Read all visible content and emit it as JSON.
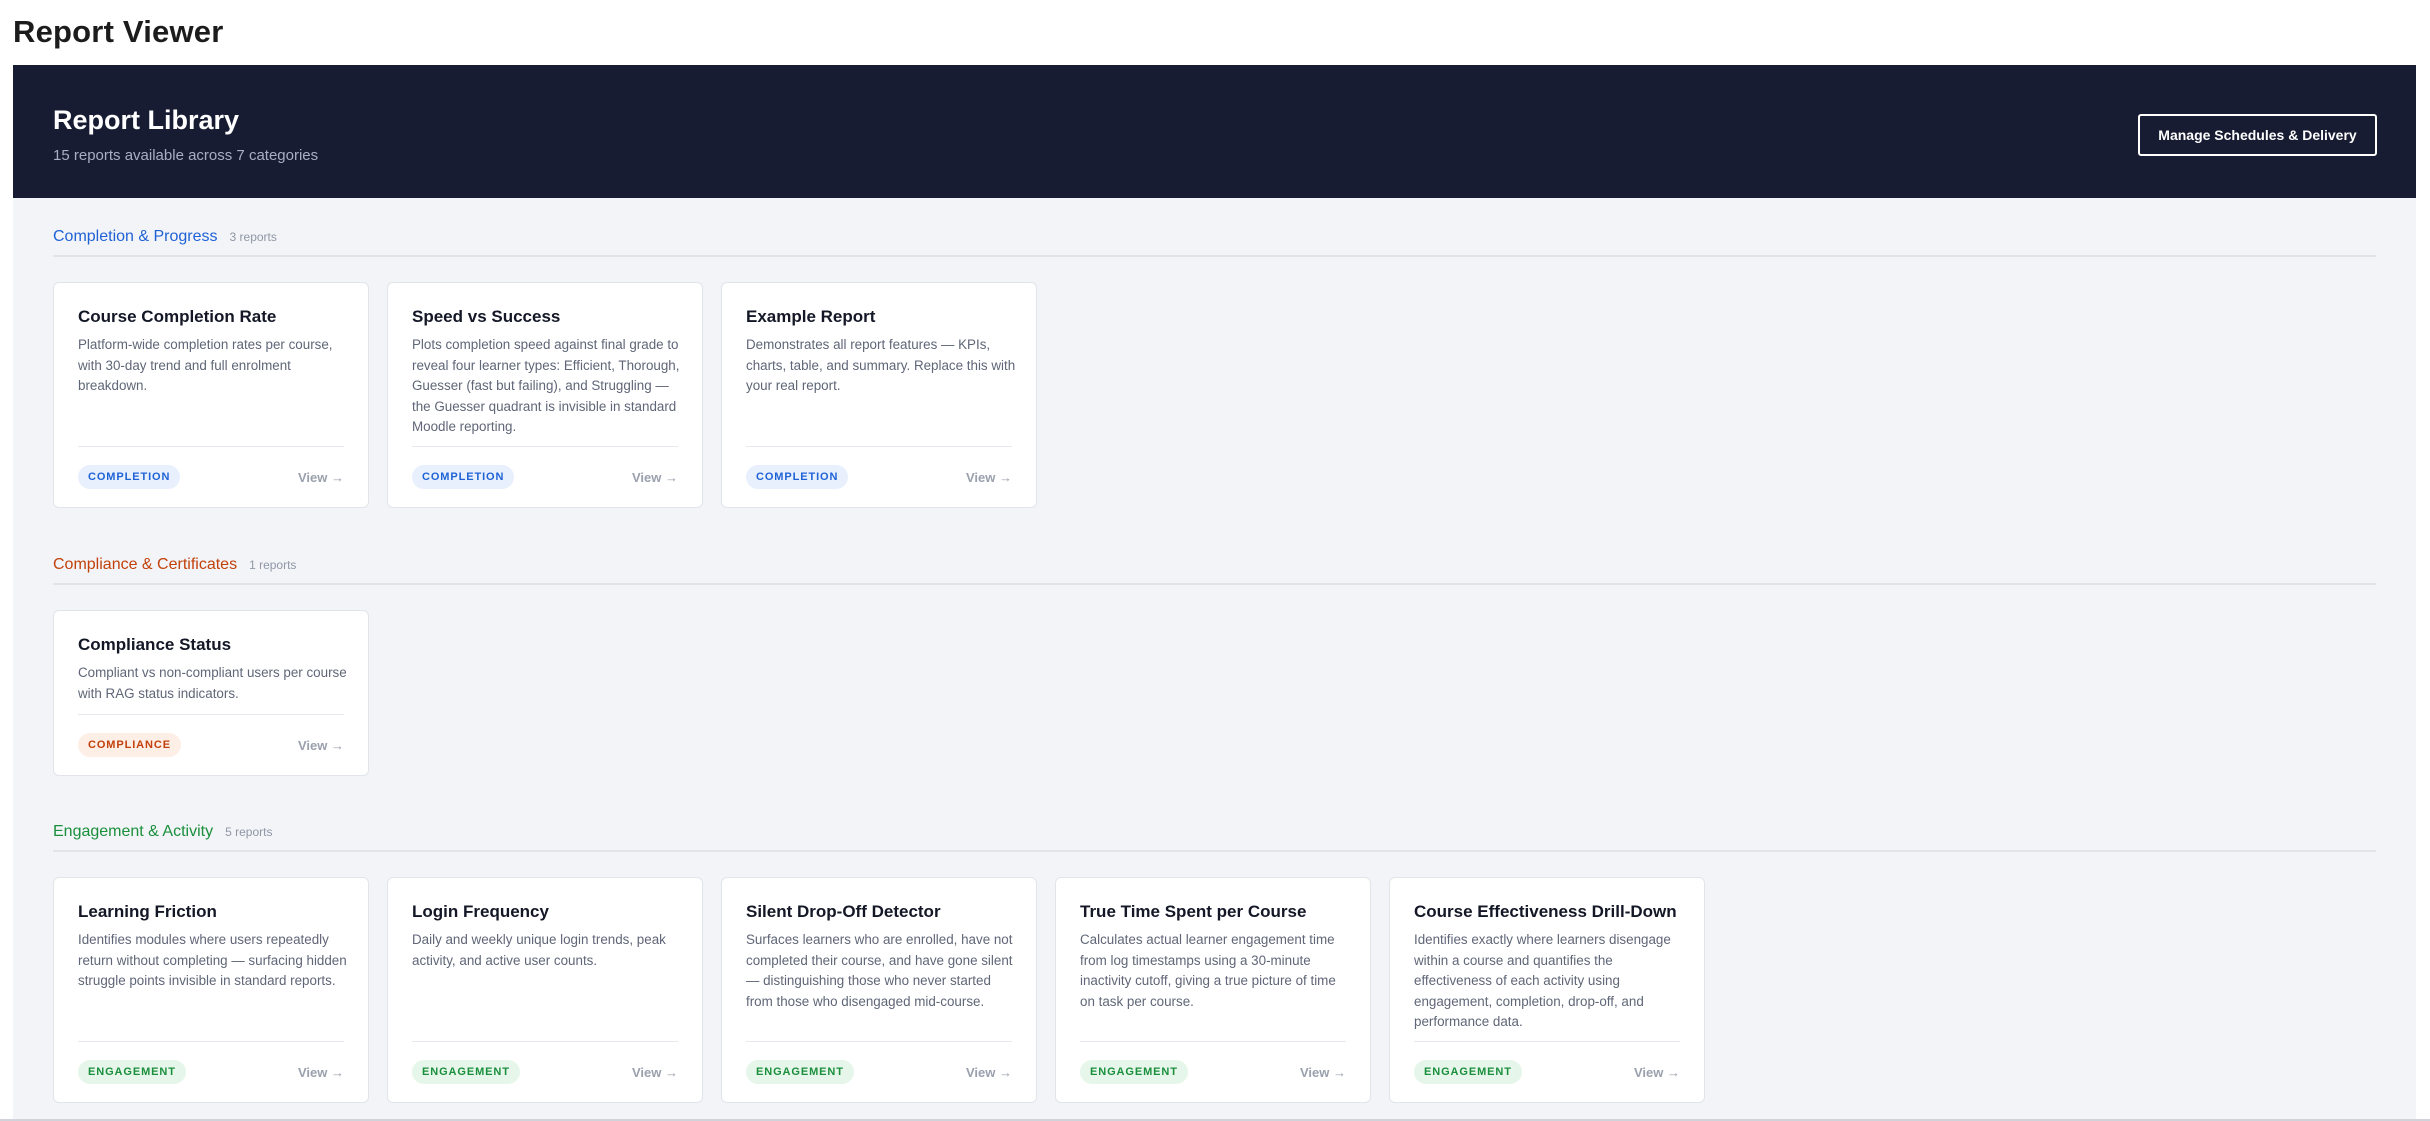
{
  "app": {
    "title": "Report Viewer"
  },
  "header": {
    "title": "Report Library",
    "subtitle": "15 reports available across 7 categories",
    "manage_label": "Manage Schedules & Delivery"
  },
  "colors": {
    "hero_bg": "#171c33",
    "completion": "#1f62d6",
    "completion_bg": "#e8f0fd",
    "compliance": "#c2410c",
    "compliance_bg": "#fdeee6",
    "engagement": "#1a8f3c",
    "engagement_bg": "#e6f6ea"
  },
  "sections": [
    {
      "name": "Completion & Progress",
      "count": "3 reports",
      "badge": "COMPLETION",
      "reports": [
        {
          "title": "Course Completion Rate",
          "description": "Platform-wide completion rates per course, with 30-day trend and full enrolment breakdown.",
          "view": "View →"
        },
        {
          "title": "Speed vs Success",
          "description": "Plots completion speed against final grade to reveal four learner types: Efficient, Thorough, Guesser (fast but failing), and Struggling — the Guesser quadrant is invisible in standard Moodle reporting.",
          "view": "View →"
        },
        {
          "title": "Example Report",
          "description": "Demonstrates all report features — KPIs, charts, table, and summary. Replace this with your real report.",
          "view": "View →"
        }
      ]
    },
    {
      "name": "Compliance & Certificates",
      "count": "1 reports",
      "badge": "COMPLIANCE",
      "reports": [
        {
          "title": "Compliance Status",
          "description": "Compliant vs non-compliant users per course with RAG status indicators.",
          "view": "View →"
        }
      ]
    },
    {
      "name": "Engagement & Activity",
      "count": "5 reports",
      "badge": "ENGAGEMENT",
      "reports": [
        {
          "title": "Learning Friction",
          "description": "Identifies modules where users repeatedly return without completing — surfacing hidden struggle points invisible in standard reports.",
          "view": "View →"
        },
        {
          "title": "Login Frequency",
          "description": "Daily and weekly unique login trends, peak activity, and active user counts.",
          "view": "View →"
        },
        {
          "title": "Silent Drop-Off Detector",
          "description": "Surfaces learners who are enrolled, have not completed their course, and have gone silent — distinguishing those who never started from those who disengaged mid-course.",
          "view": "View →"
        },
        {
          "title": "True Time Spent per Course",
          "description": "Calculates actual learner engagement time from log timestamps using a 30-minute inactivity cutoff, giving a true picture of time on task per course.",
          "view": "View →"
        },
        {
          "title": "Course Effectiveness Drill-Down",
          "description": "Identifies exactly where learners disengage within a course and quantifies the effectiveness of each activity using engagement, completion, drop-off, and performance data.",
          "view": "View →"
        }
      ]
    }
  ]
}
